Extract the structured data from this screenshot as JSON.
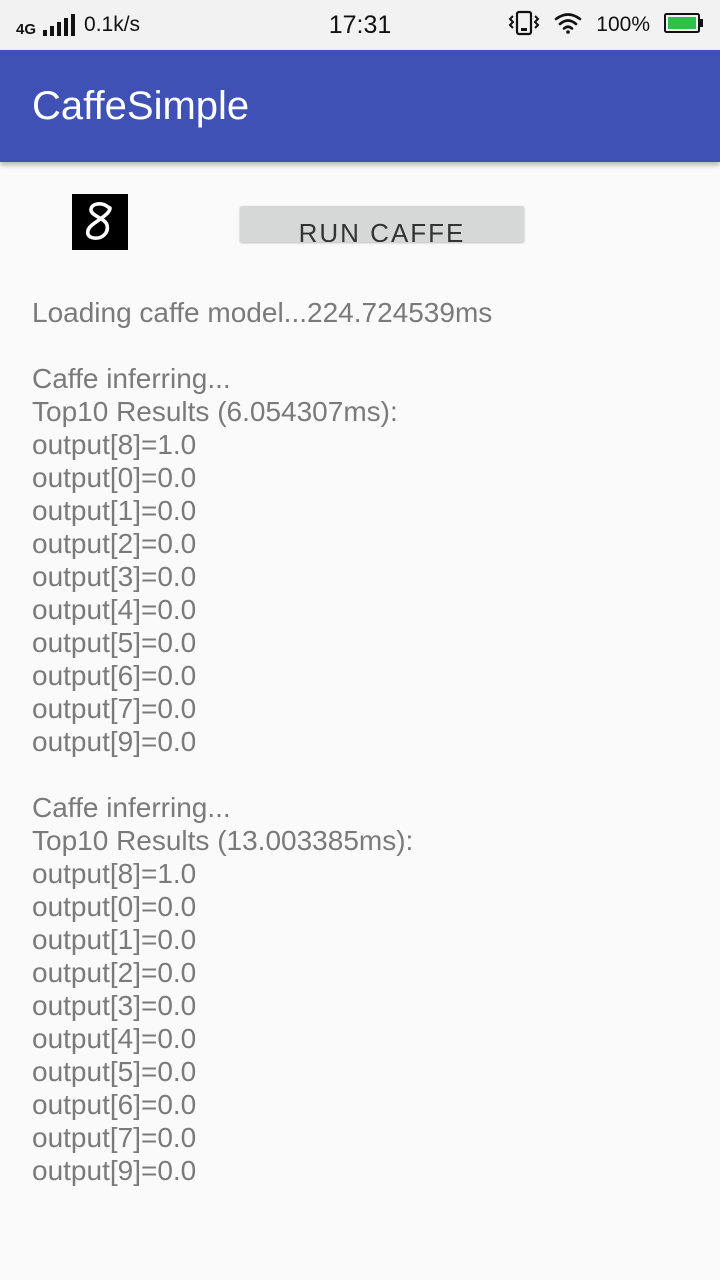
{
  "status_bar": {
    "network_type": "4G",
    "speed": "0.1k/s",
    "time": "17:31",
    "battery_percent": "100%",
    "icons": [
      "signal-icon",
      "vibrate-icon",
      "wifi-icon",
      "battery-icon"
    ]
  },
  "app_bar": {
    "title": "CaffeSimple",
    "color": "#3f51b5"
  },
  "digit_image": {
    "description_icon": "handwritten-digit-8",
    "digit": "8"
  },
  "run_button": {
    "label": "RUN CAFFE"
  },
  "log": {
    "loading_line": "Loading caffe model...224.724539ms",
    "runs": [
      {
        "header": "Caffe inferring...",
        "results_title": "Top10 Results (6.054307ms):",
        "outputs": [
          "output[8]=1.0",
          "output[0]=0.0",
          "output[1]=0.0",
          "output[2]=0.0",
          "output[3]=0.0",
          "output[4]=0.0",
          "output[5]=0.0",
          "output[6]=0.0",
          "output[7]=0.0",
          "output[9]=0.0"
        ]
      },
      {
        "header": "Caffe inferring...",
        "results_title": "Top10 Results (13.003385ms):",
        "outputs": [
          "output[8]=1.0",
          "output[0]=0.0",
          "output[1]=0.0",
          "output[2]=0.0",
          "output[3]=0.0",
          "output[4]=0.0",
          "output[5]=0.0",
          "output[6]=0.0",
          "output[7]=0.0",
          "output[9]=0.0"
        ]
      }
    ]
  }
}
